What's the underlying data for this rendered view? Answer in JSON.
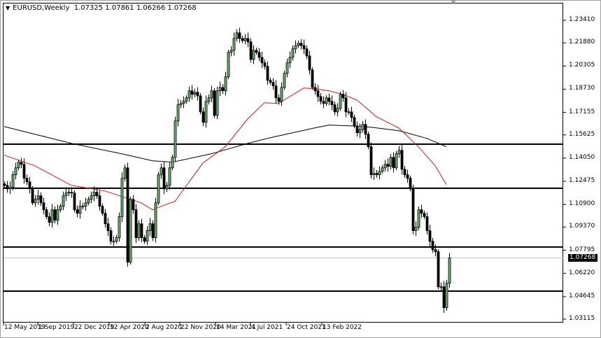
{
  "header": {
    "symbol_tf": "EURUSD,Weekly",
    "open": "1.07325",
    "high": "1.07861",
    "low": "1.06266",
    "close": "1.07268"
  },
  "current_price": "1.07268",
  "colors": {
    "bull": "#6ab86a",
    "bear": "#000000",
    "ma_fast": "#d01818",
    "ma_slow": "#000000",
    "levels": "#000000",
    "current_line": "#c0c0c0"
  },
  "chart_data": {
    "type": "candlestick",
    "title": "EURUSD,Weekly",
    "y_ticks": [
      "1.23410",
      "1.21880",
      "1.20305",
      "1.18730",
      "1.17155",
      "1.15625",
      "1.14050",
      "1.12475",
      "1.10900",
      "1.09370",
      "1.07795",
      "1.06220",
      "1.04645",
      "1.03115"
    ],
    "x_ticks": [
      "12 May 2019",
      "1 Sep 2019",
      "22 Dec 2019",
      "12 Apr 2020",
      "2 Aug 2020",
      "22 Nov 2020",
      "14 Mar 2021",
      "4 Jul 2021",
      "24 Oct 2021",
      "13 Feb 2022"
    ],
    "ylim": [
      1.03115,
      1.2341
    ],
    "first_open": 1.123,
    "closes": [
      1.122,
      1.1196,
      1.1206,
      1.1292,
      1.1339,
      1.1377,
      1.1363,
      1.1268,
      1.1244,
      1.1196,
      1.1101,
      1.1125,
      1.1149,
      1.1101,
      1.1054,
      1.1007,
      1.0969,
      1.1054,
      1.0983,
      1.1054,
      1.1078,
      1.1149,
      1.1168,
      1.1173,
      1.1168,
      1.1054,
      1.103,
      1.1078,
      1.1078,
      1.1101,
      1.1125,
      1.1149,
      1.1173,
      1.1149,
      1.1078,
      1.103,
      1.0959,
      1.0912,
      1.084,
      1.084,
      1.0864,
      1.1007,
      1.1268,
      1.1339,
      1.0698,
      1.1125,
      1.1054,
      1.0864,
      1.0959,
      1.0864,
      1.084,
      1.0912,
      1.0959,
      1.0864,
      1.1101,
      1.1292,
      1.1339,
      1.1196,
      1.122,
      1.1339,
      1.141,
      1.1657,
      1.1767,
      1.1776,
      1.179,
      1.1814,
      1.1862,
      1.1838,
      1.1852,
      1.1828,
      1.1719,
      1.1648,
      1.179,
      1.1814,
      1.1862,
      1.1695,
      1.1862,
      1.1885,
      1.1862,
      1.1957,
      1.2123,
      1.2137,
      1.2218,
      1.2256,
      1.2218,
      1.2203,
      1.2218,
      1.2194,
      1.2075,
      1.2137,
      1.2123,
      1.2089,
      1.2052,
      1.2028,
      1.1933,
      1.1919,
      1.1895,
      1.1814,
      1.179,
      1.1885,
      1.198,
      1.2052,
      1.2089,
      1.2147,
      1.217,
      1.2185,
      1.217,
      1.2147,
      1.2099,
      1.2004,
      1.1885,
      1.1862,
      1.1823,
      1.179,
      1.1776,
      1.1814,
      1.179,
      1.1767,
      1.1719,
      1.1743,
      1.1838,
      1.1814,
      1.1719,
      1.1719,
      1.1681,
      1.1624,
      1.1577,
      1.16,
      1.1634,
      1.1567,
      1.1482,
      1.1292,
      1.1301,
      1.1292,
      1.1315,
      1.1339,
      1.1363,
      1.1349,
      1.141,
      1.1339,
      1.1434,
      1.1458,
      1.1329,
      1.1292,
      1.1268,
      1.1196,
      1.0912,
      1.0935,
      1.1054,
      1.103,
      1.1007,
      1.0912,
      1.084,
      1.0783,
      1.0769,
      1.0531,
      1.0531,
      1.0389,
      1.0555,
      1.07268
    ],
    "ma_fast": [
      [
        0,
        1.1425
      ],
      [
        11,
        1.1353
      ],
      [
        24,
        1.122
      ],
      [
        36,
        1.1182
      ],
      [
        49,
        1.1101
      ],
      [
        53,
        1.1054
      ],
      [
        58,
        1.1092
      ],
      [
        61,
        1.1111
      ],
      [
        71,
        1.1372
      ],
      [
        79,
        1.1482
      ],
      [
        87,
        1.1671
      ],
      [
        93,
        1.1781
      ],
      [
        98,
        1.1776
      ],
      [
        107,
        1.1881
      ],
      [
        111,
        1.1876
      ],
      [
        116,
        1.1862
      ],
      [
        121,
        1.1838
      ],
      [
        126,
        1.18
      ],
      [
        133,
        1.1686
      ],
      [
        141,
        1.161
      ],
      [
        148,
        1.1482
      ],
      [
        154,
        1.1353
      ],
      [
        158,
        1.1225
      ]
    ],
    "ma_slow": [
      [
        0,
        1.1619
      ],
      [
        24,
        1.1505
      ],
      [
        42,
        1.1434
      ],
      [
        53,
        1.1387
      ],
      [
        60,
        1.1377
      ],
      [
        74,
        1.1434
      ],
      [
        87,
        1.1505
      ],
      [
        95,
        1.1543
      ],
      [
        111,
        1.161
      ],
      [
        116,
        1.1629
      ],
      [
        124,
        1.1624
      ],
      [
        131,
        1.1615
      ],
      [
        141,
        1.1591
      ],
      [
        151,
        1.1539
      ],
      [
        158,
        1.1482
      ]
    ],
    "horizontal_levels": [
      1.15,
      1.12,
      1.08,
      1.05
    ]
  }
}
